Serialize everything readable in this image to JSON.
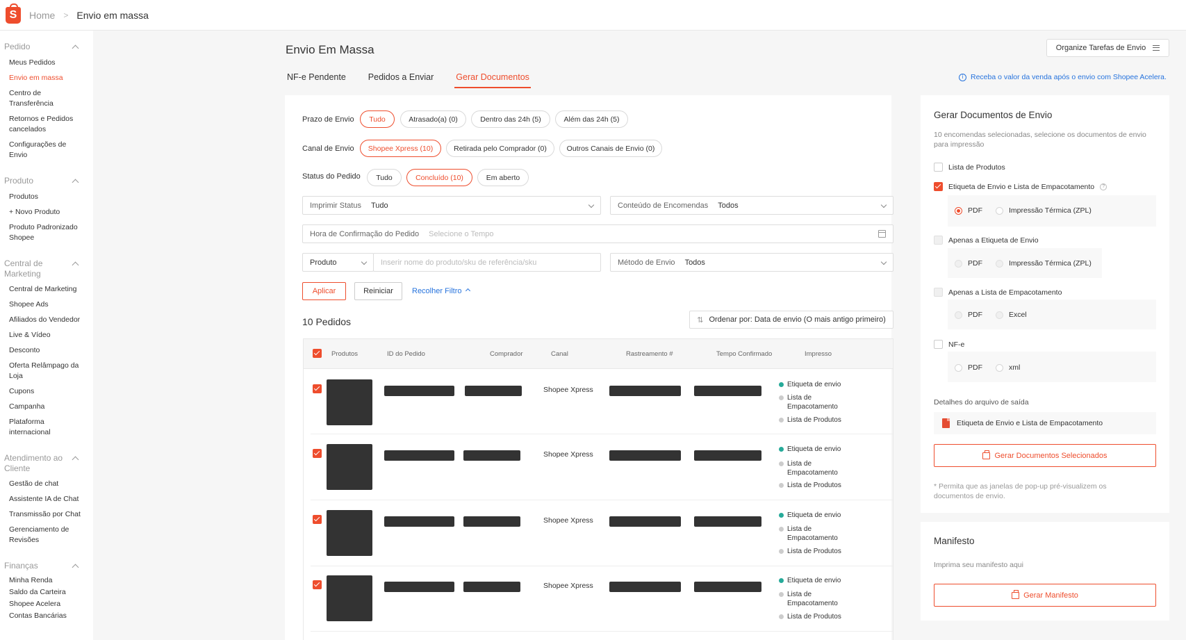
{
  "breadcrumb": {
    "home": "Home",
    "current": "Envio em massa"
  },
  "sidebar": {
    "groups": [
      {
        "title": "Pedido",
        "items": [
          "Meus Pedidos",
          "Envio em massa",
          "Centro de Transferência",
          "Retornos e Pedidos cancelados",
          "Configurações de Envio"
        ],
        "active": "Envio em massa"
      },
      {
        "title": "Produto",
        "items": [
          "Produtos",
          "+ Novo Produto",
          "Produto Padronizado Shopee"
        ]
      },
      {
        "title": "Central de Marketing",
        "items": [
          "Central de Marketing",
          "Shopee Ads",
          "Afiliados do Vendedor",
          "Live & Vídeo",
          "Desconto",
          "Oferta Relâmpago da Loja",
          "Cupons",
          "Campanha",
          "Plataforma internacional"
        ]
      },
      {
        "title": "Atendimento ao Cliente",
        "items": [
          "Gestão de chat",
          "Assistente IA de Chat",
          "Transmissão por Chat",
          "Gerenciamento de Revisões"
        ]
      },
      {
        "title": "Finanças",
        "items": [
          "Minha Renda",
          "Saldo da Carteira",
          "Shopee Acelera",
          "Contas Bancárias"
        ]
      }
    ]
  },
  "header": {
    "title": "Envio Em Massa",
    "organize_button": "Organize Tarefas de Envio",
    "tabs": [
      "NF-e Pendente",
      "Pedidos a Enviar",
      "Gerar Documentos"
    ],
    "active_tab": "Gerar Documentos",
    "acelera_notice": "Receba o valor da venda após o envio com Shopee Acelera."
  },
  "filters": {
    "prazo_label": "Prazo de Envio",
    "prazo_options": [
      "Tudo",
      "Atrasado(a) (0)",
      "Dentro das 24h (5)",
      "Além das 24h (5)"
    ],
    "canal_label": "Canal de Envio",
    "canal_options": [
      "Shopee Xpress (10)",
      "Retirada pelo Comprador (0)",
      "Outros Canais de Envio (0)"
    ],
    "status_label": "Status do Pedido",
    "status_options": [
      "Tudo",
      "Concluído (10)",
      "Em aberto"
    ],
    "imprimir_label": "Imprimir Status",
    "imprimir_value": "Tudo",
    "conteudo_label": "Conteúdo de Encomendas",
    "conteudo_value": "Todos",
    "hora_label": "Hora de Confirmação do Pedido",
    "hora_placeholder": "Selecione o Tempo",
    "produto_select": "Produto",
    "produto_placeholder": "Inserir nome do produto/sku de referência/sku",
    "metodo_label": "Método de Envio",
    "metodo_value": "Todos",
    "apply": "Aplicar",
    "reset": "Reiniciar",
    "collapse": "Recolher Filtro"
  },
  "orders": {
    "count_label": "10 Pedidos",
    "sort_label": "Ordenar por: Data de envio (O mais antigo primeiro)",
    "columns": [
      "Produtos",
      "ID do Pedido",
      "Comprador",
      "Canal",
      "Rastreamento #",
      "Tempo Confirmado",
      "Impresso"
    ],
    "rows": [
      {
        "canal": "Shopee Xpress",
        "printed": [
          "Etiqueta de envio",
          "Lista de Empacotamento",
          "Lista de Produtos"
        ]
      },
      {
        "canal": "Shopee Xpress",
        "printed": [
          "Etiqueta de envio",
          "Lista de Empacotamento",
          "Lista de Produtos"
        ]
      },
      {
        "canal": "Shopee Xpress",
        "printed": [
          "Etiqueta de envio",
          "Lista de Empacotamento",
          "Lista de Produtos"
        ]
      },
      {
        "canal": "Shopee Xpress",
        "printed": [
          "Etiqueta de envio",
          "Lista de Empacotamento",
          "Lista de Produtos"
        ]
      }
    ]
  },
  "docs_panel": {
    "title": "Gerar Documentos de Envio",
    "subtitle": "10 encomendas selecionadas, selecione os documentos de envio para impressão",
    "opt_lista_produtos": "Lista de Produtos",
    "opt_etiqueta_lista": "Etiqueta de Envio e Lista de Empacotamento",
    "opt_apenas_etiqueta": "Apenas a Etiqueta de Envio",
    "opt_apenas_lista": "Apenas a Lista de Empacotamento",
    "opt_nfe": "NF-e",
    "pdf": "PDF",
    "termica": "Impressão Térmica (ZPL)",
    "excel": "Excel",
    "xml": "xml",
    "output_label": "Detalhes do arquivo de saída",
    "output_file": "Etiqueta de Envio e Lista de Empacotamento",
    "generate_button": "Gerar Documentos Selecionados",
    "popup_note": "* Permita que as janelas de pop-up pré-visualizem os documentos de envio."
  },
  "manifest": {
    "title": "Manifesto",
    "subtitle": "Imprima seu manifesto aqui",
    "button": "Gerar Manifesto"
  },
  "colors": {
    "accent": "#ee4d2d",
    "link": "#2673dd",
    "success": "#26aa99"
  }
}
